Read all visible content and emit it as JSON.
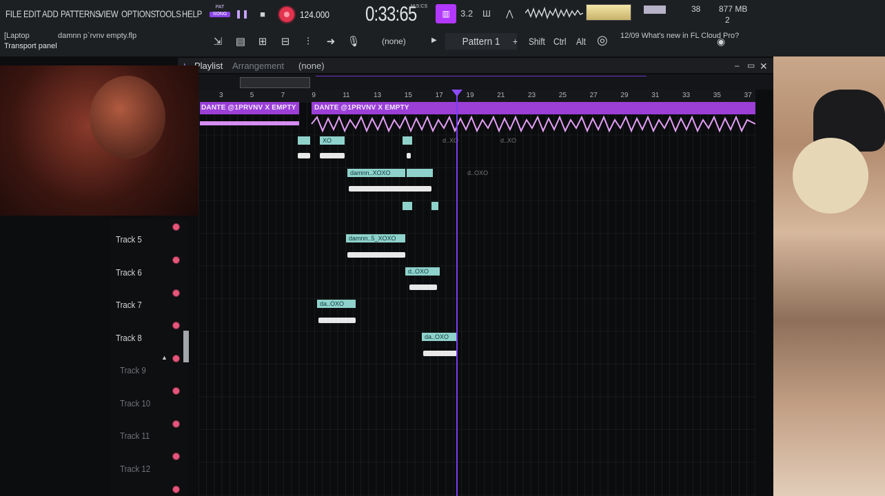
{
  "menu": [
    "FILE",
    "EDIT",
    "ADD",
    "PATTERNS",
    "VIEW",
    "OPTIONS",
    "TOOLS",
    "HELP"
  ],
  "transport": {
    "pat_label": "PAT",
    "song_label": "SONG",
    "tempo": "124.000",
    "time": "0:33:65",
    "time_unit": "M:S:CS",
    "cpu": "38",
    "memory": "877 MB",
    "voices": "2"
  },
  "status": {
    "context": "[Laptop",
    "file": "damnn p`rvnv empty.flp",
    "hint": "Transport panel"
  },
  "toolbar": {
    "none_label": "(none)",
    "pattern": "Pattern 1",
    "keys": [
      "Shift",
      "Ctrl",
      "Alt"
    ],
    "news_date": "12/09",
    "news_text": "What's new in FL Cloud Pro?"
  },
  "playlist": {
    "title": "Playlist",
    "subtitle": "Arrangement",
    "selector": "(none)",
    "ruler": [
      "3",
      "5",
      "7",
      "9",
      "11",
      "13",
      "15",
      "17",
      "19",
      "21",
      "23",
      "25",
      "27",
      "29",
      "31",
      "33",
      "35",
      "37"
    ]
  },
  "lanes": {
    "left": "DANTE @1PRVNV X EMPTY",
    "right": "DANTE @1PRVNV X EMPTY"
  },
  "clips": [
    "XO",
    "damnn..XOXO",
    "damnn..5_XOXO",
    "d..OXO",
    "da..OXO",
    "da..OXO"
  ],
  "ghost_clips": [
    "d..XO",
    "d..XO",
    "d..OXO"
  ],
  "tracks": [
    {
      "name": "Track 5",
      "dim": false
    },
    {
      "name": "Track 6",
      "dim": false
    },
    {
      "name": "Track 7",
      "dim": false
    },
    {
      "name": "Track 8",
      "dim": false
    },
    {
      "name": "Track 9",
      "dim": true
    },
    {
      "name": "Track 10",
      "dim": true
    },
    {
      "name": "Track 11",
      "dim": true
    },
    {
      "name": "Track 12",
      "dim": true
    }
  ]
}
